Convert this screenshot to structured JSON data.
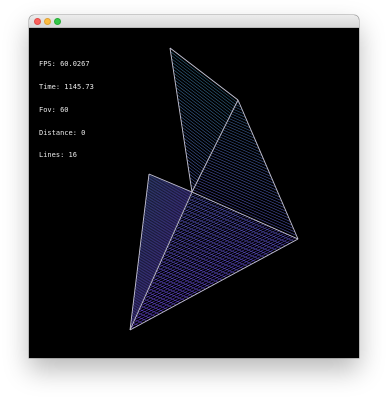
{
  "window": {
    "traffic_lights": [
      "close",
      "minimize",
      "maximize"
    ]
  },
  "hud": {
    "fps_label": "FPS:",
    "fps": "60.0267",
    "time_label": "Time:",
    "time": "1145.73",
    "fov_label": "Fov:",
    "fov": "60",
    "distance_label": "Distance:",
    "distance": "0",
    "lines_label": "Lines:",
    "lines": "16"
  },
  "scene": {
    "background": "#000000",
    "outline_color": "#c4c2d2",
    "color_top": "#2c6f7f",
    "color_bottom": "#6c3ad9",
    "hatch_count": 40
  }
}
